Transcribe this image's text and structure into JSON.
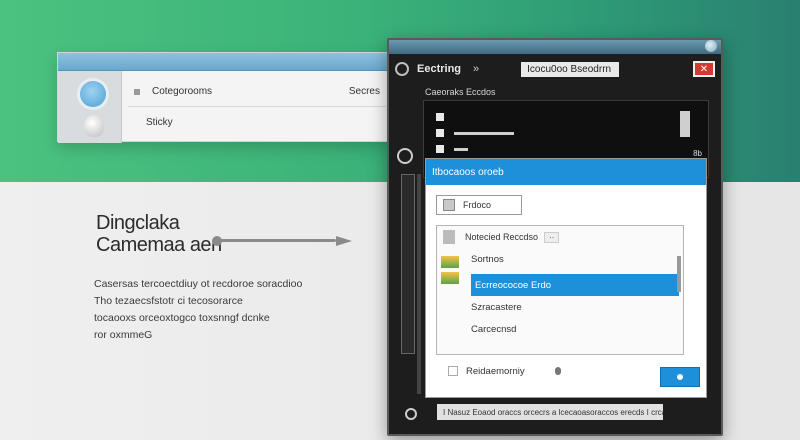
{
  "left_window": {
    "row1_label": "Cotegorooms",
    "row1_right": "Secres",
    "row2_label": "Sticky"
  },
  "heading": {
    "line1": "Dingclaka",
    "line2": "Camemaa aen"
  },
  "description": {
    "lines": [
      "Casersas tercoectdiuy ot recdoroe soracdioo",
      "Tho tezaecsfstotr ci tecosorarce",
      "tocaooxs orceoxtogco toxsnngf dcnke",
      "ror oxmmeG"
    ]
  },
  "right_window": {
    "title": "Eectring",
    "title_chevron": "»",
    "tab_label": "Icocu0oo Bseodrrn",
    "close_label": "✕",
    "subbar_label": "Caeoraks Eccdos",
    "dialog": {
      "header": "Itbocaoos oroeb",
      "counter": "8b",
      "input_value": "Frdoco",
      "list_header": "Notecied Reccdso",
      "list_badge": "··",
      "items": [
        "Sortnos",
        "Ecrreococoe Erdo",
        "Szracastere",
        "Carcecnsd"
      ],
      "selected_index": 1,
      "footer_label": "Reidaemorniy"
    },
    "status": "I Nasuz Eoaod oraccs orcecrs a lcecaoasoraccos erecds I crcans ero"
  },
  "colors": {
    "accent": "#1e8fd9",
    "green_top": "#3bb279",
    "close_red": "#d23b2f"
  }
}
